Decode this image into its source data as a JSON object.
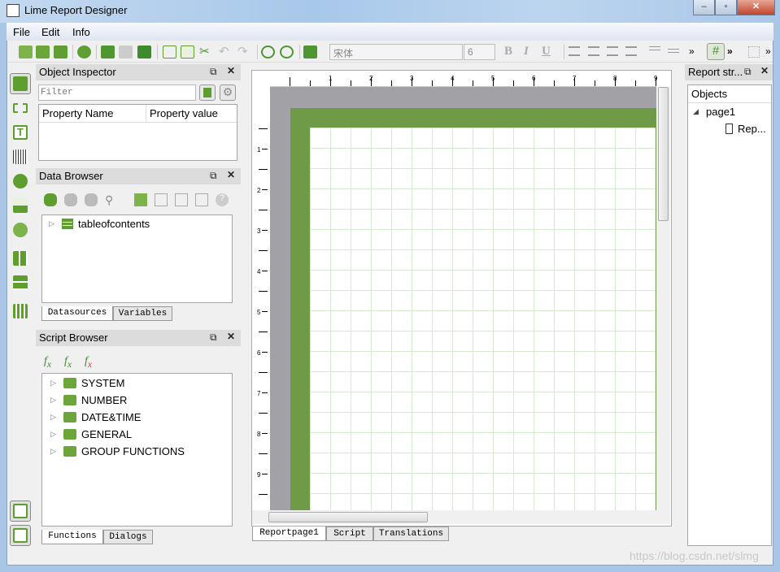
{
  "window": {
    "title": "Lime Report Designer"
  },
  "menu": [
    "File",
    "Edit",
    "Info"
  ],
  "toolbar": {
    "font": "宋体",
    "size": "6",
    "bold": "B",
    "italic": "I",
    "underline": "U",
    "more": "»"
  },
  "object_inspector": {
    "title": "Object Inspector",
    "filter_placeholder": "Filter",
    "col_name": "Property Name",
    "col_value": "Property value"
  },
  "data_browser": {
    "title": "Data Browser",
    "items": [
      "tableofcontents"
    ],
    "tabs": [
      "Datasources",
      "Variables"
    ]
  },
  "script_browser": {
    "title": "Script Browser",
    "items": [
      "SYSTEM",
      "NUMBER",
      "DATE&TIME",
      "GENERAL",
      "GROUP FUNCTIONS"
    ],
    "tabs": [
      "Functions",
      "Dialogs"
    ]
  },
  "designer": {
    "ruler_top": [
      "1",
      "2",
      "3",
      "4",
      "5",
      "6",
      "7",
      "8",
      "9"
    ],
    "ruler_left": [
      "1",
      "2",
      "3",
      "4",
      "5",
      "6",
      "7",
      "8",
      "9"
    ],
    "tabs": [
      "Reportpage1",
      "Script",
      "Translations"
    ],
    "page_color": "#6f9a47"
  },
  "report_structure": {
    "title": "Report str...",
    "header": "Objects",
    "page": "page1",
    "child": "Rep..."
  },
  "watermark": "https://blog.csdn.net/slmg"
}
